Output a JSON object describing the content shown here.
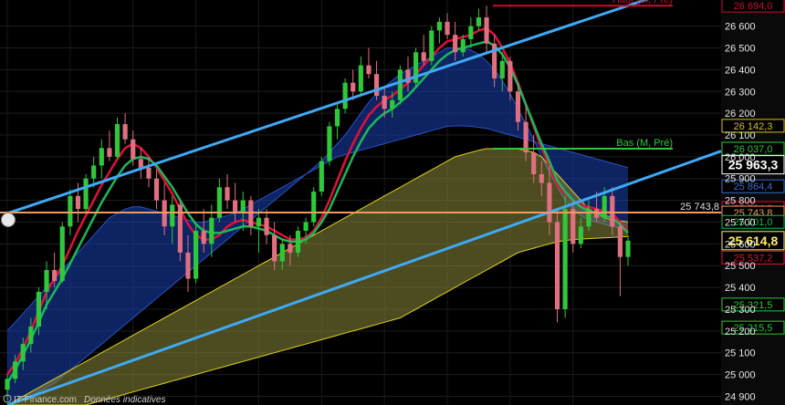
{
  "chart_data": {
    "type": "candlestick",
    "title": "",
    "y_axis": {
      "min": 24860,
      "max": 26720,
      "ticks": [
        24900,
        25000,
        25100,
        25200,
        25300,
        25400,
        25500,
        25600,
        25700,
        25800,
        25900,
        26000,
        26100,
        26200,
        26300,
        26400,
        26500,
        26600
      ],
      "tick_labels": [
        "24 900",
        "25 000",
        "25 100",
        "25 200",
        "25 300",
        "25 400",
        "25 500",
        "25 600",
        "25 700",
        "25 800",
        "25 900",
        "26 000",
        "26 100",
        "26 200",
        "26 300",
        "26 400",
        "26 500",
        "26 600"
      ]
    },
    "grid": true,
    "candles": [
      {
        "o": 24930,
        "h": 25000,
        "l": 24880,
        "c": 24980
      },
      {
        "o": 24980,
        "h": 25090,
        "l": 24960,
        "c": 25060
      },
      {
        "o": 25060,
        "h": 25170,
        "l": 25020,
        "c": 25140
      },
      {
        "o": 25140,
        "h": 25260,
        "l": 25100,
        "c": 25220
      },
      {
        "o": 25220,
        "h": 25400,
        "l": 25180,
        "c": 25380
      },
      {
        "o": 25380,
        "h": 25520,
        "l": 25300,
        "c": 25480
      },
      {
        "o": 25480,
        "h": 25560,
        "l": 25400,
        "c": 25430
      },
      {
        "o": 25430,
        "h": 25700,
        "l": 25420,
        "c": 25680
      },
      {
        "o": 25680,
        "h": 25850,
        "l": 25640,
        "c": 25820
      },
      {
        "o": 25820,
        "h": 25880,
        "l": 25700,
        "c": 25760
      },
      {
        "o": 25760,
        "h": 25920,
        "l": 25740,
        "c": 25900
      },
      {
        "o": 25900,
        "h": 26000,
        "l": 25860,
        "c": 25960
      },
      {
        "o": 25960,
        "h": 26080,
        "l": 25900,
        "c": 26040
      },
      {
        "o": 26040,
        "h": 26120,
        "l": 25980,
        "c": 26000
      },
      {
        "o": 26000,
        "h": 26180,
        "l": 25990,
        "c": 26150
      },
      {
        "o": 26150,
        "h": 26200,
        "l": 26060,
        "c": 26080
      },
      {
        "o": 26080,
        "h": 26120,
        "l": 25960,
        "c": 25990
      },
      {
        "o": 25990,
        "h": 26040,
        "l": 25900,
        "c": 25950
      },
      {
        "o": 25950,
        "h": 26000,
        "l": 25860,
        "c": 25900
      },
      {
        "o": 25900,
        "h": 25940,
        "l": 25760,
        "c": 25800
      },
      {
        "o": 25800,
        "h": 25880,
        "l": 25640,
        "c": 25680
      },
      {
        "o": 25680,
        "h": 25820,
        "l": 25600,
        "c": 25780
      },
      {
        "o": 25780,
        "h": 25800,
        "l": 25520,
        "c": 25560
      },
      {
        "o": 25560,
        "h": 25640,
        "l": 25380,
        "c": 25440
      },
      {
        "o": 25440,
        "h": 25700,
        "l": 25420,
        "c": 25660
      },
      {
        "o": 25660,
        "h": 25760,
        "l": 25560,
        "c": 25600
      },
      {
        "o": 25600,
        "h": 25780,
        "l": 25540,
        "c": 25720
      },
      {
        "o": 25720,
        "h": 25900,
        "l": 25700,
        "c": 25860
      },
      {
        "o": 25860,
        "h": 25920,
        "l": 25760,
        "c": 25800
      },
      {
        "o": 25800,
        "h": 25880,
        "l": 25700,
        "c": 25740
      },
      {
        "o": 25740,
        "h": 25840,
        "l": 25660,
        "c": 25800
      },
      {
        "o": 25800,
        "h": 25820,
        "l": 25640,
        "c": 25680
      },
      {
        "o": 25680,
        "h": 25760,
        "l": 25560,
        "c": 25720
      },
      {
        "o": 25720,
        "h": 25760,
        "l": 25600,
        "c": 25640
      },
      {
        "o": 25640,
        "h": 25700,
        "l": 25480,
        "c": 25520
      },
      {
        "o": 25520,
        "h": 25620,
        "l": 25480,
        "c": 25600
      },
      {
        "o": 25600,
        "h": 25640,
        "l": 25500,
        "c": 25560
      },
      {
        "o": 25560,
        "h": 25680,
        "l": 25540,
        "c": 25660
      },
      {
        "o": 25660,
        "h": 25720,
        "l": 25600,
        "c": 25700
      },
      {
        "o": 25700,
        "h": 25860,
        "l": 25680,
        "c": 25840
      },
      {
        "o": 25840,
        "h": 26000,
        "l": 25820,
        "c": 25980
      },
      {
        "o": 25980,
        "h": 26160,
        "l": 25960,
        "c": 26140
      },
      {
        "o": 26140,
        "h": 26240,
        "l": 26080,
        "c": 26220
      },
      {
        "o": 26220,
        "h": 26360,
        "l": 26200,
        "c": 26340
      },
      {
        "o": 26340,
        "h": 26400,
        "l": 26260,
        "c": 26300
      },
      {
        "o": 26300,
        "h": 26460,
        "l": 26280,
        "c": 26420
      },
      {
        "o": 26420,
        "h": 26500,
        "l": 26360,
        "c": 26380
      },
      {
        "o": 26380,
        "h": 26440,
        "l": 26260,
        "c": 26280
      },
      {
        "o": 26280,
        "h": 26320,
        "l": 26180,
        "c": 26220
      },
      {
        "o": 26220,
        "h": 26300,
        "l": 26180,
        "c": 26260
      },
      {
        "o": 26260,
        "h": 26420,
        "l": 26240,
        "c": 26400
      },
      {
        "o": 26400,
        "h": 26460,
        "l": 26300,
        "c": 26340
      },
      {
        "o": 26340,
        "h": 26500,
        "l": 26320,
        "c": 26480
      },
      {
        "o": 26480,
        "h": 26560,
        "l": 26420,
        "c": 26440
      },
      {
        "o": 26440,
        "h": 26600,
        "l": 26420,
        "c": 26580
      },
      {
        "o": 26580,
        "h": 26640,
        "l": 26520,
        "c": 26620
      },
      {
        "o": 26620,
        "h": 26660,
        "l": 26540,
        "c": 26560
      },
      {
        "o": 26560,
        "h": 26620,
        "l": 26440,
        "c": 26480
      },
      {
        "o": 26480,
        "h": 26560,
        "l": 26460,
        "c": 26540
      },
      {
        "o": 26540,
        "h": 26640,
        "l": 26500,
        "c": 26600
      },
      {
        "o": 26600,
        "h": 26680,
        "l": 26580,
        "c": 26640
      },
      {
        "o": 26640,
        "h": 26694,
        "l": 26480,
        "c": 26520
      },
      {
        "o": 26520,
        "h": 26560,
        "l": 26320,
        "c": 26360
      },
      {
        "o": 26360,
        "h": 26480,
        "l": 26300,
        "c": 26440
      },
      {
        "o": 26440,
        "h": 26460,
        "l": 26260,
        "c": 26300
      },
      {
        "o": 26300,
        "h": 26340,
        "l": 26120,
        "c": 26160
      },
      {
        "o": 26160,
        "h": 26240,
        "l": 25980,
        "c": 26020
      },
      {
        "o": 26020,
        "h": 26100,
        "l": 25880,
        "c": 25920
      },
      {
        "o": 25920,
        "h": 25980,
        "l": 25820,
        "c": 25880
      },
      {
        "o": 25880,
        "h": 25960,
        "l": 25640,
        "c": 25700
      },
      {
        "o": 25700,
        "h": 25760,
        "l": 25240,
        "c": 25300
      },
      {
        "o": 25300,
        "h": 25820,
        "l": 25260,
        "c": 25760
      },
      {
        "o": 25760,
        "h": 25800,
        "l": 25560,
        "c": 25600
      },
      {
        "o": 25600,
        "h": 25720,
        "l": 25580,
        "c": 25680
      },
      {
        "o": 25680,
        "h": 25800,
        "l": 25660,
        "c": 25760
      },
      {
        "o": 25760,
        "h": 25840,
        "l": 25700,
        "c": 25720
      },
      {
        "o": 25720,
        "h": 25860,
        "l": 25700,
        "c": 25820
      },
      {
        "o": 25820,
        "h": 25860,
        "l": 25640,
        "c": 25680
      },
      {
        "o": 25680,
        "h": 25700,
        "l": 25360,
        "c": 25540
      },
      {
        "o": 25540,
        "h": 25640,
        "l": 25500,
        "c": 25614.8
      }
    ],
    "channel_lines": [
      {
        "name": "",
        "color": "#3fa9f5",
        "points": [
          [
            0,
            25740
          ],
          [
            79,
            26694
          ]
        ]
      },
      {
        "name": "",
        "color": "#3fa9f5",
        "points": [
          [
            0,
            24860
          ],
          [
            120,
            26400
          ]
        ]
      }
    ],
    "moving_averages": [
      {
        "color": "#e0103a",
        "values": [
          25000,
          25050,
          25120,
          25200,
          25290,
          25380,
          25440,
          25500,
          25580,
          25660,
          25730,
          25800,
          25870,
          25930,
          25990,
          26040,
          26060,
          26040,
          26000,
          25950,
          25890,
          25830,
          25760,
          25690,
          25640,
          25620,
          25620,
          25640,
          25680,
          25700,
          25710,
          25700,
          25690,
          25680,
          25660,
          25640,
          25620,
          25620,
          25630,
          25660,
          25720,
          25800,
          25890,
          25980,
          26060,
          26130,
          26190,
          26230,
          26260,
          26280,
          26310,
          26340,
          26380,
          26420,
          26460,
          26500,
          26530,
          26540,
          26550,
          26560,
          26580,
          26590,
          26560,
          26500,
          26430,
          26340,
          26240,
          26140,
          26040,
          25960,
          25870,
          25830,
          25800,
          25780,
          25770,
          25760,
          25750,
          25740,
          25700,
          25660
        ]
      },
      {
        "color": "#1ab85a",
        "values": [
          24960,
          25020,
          25090,
          25160,
          25240,
          25320,
          25380,
          25440,
          25510,
          25580,
          25650,
          25720,
          25790,
          25850,
          25910,
          25960,
          25990,
          26000,
          25990,
          25960,
          25910,
          25860,
          25800,
          25740,
          25690,
          25660,
          25650,
          25650,
          25660,
          25670,
          25680,
          25680,
          25670,
          25660,
          25640,
          25620,
          25610,
          25610,
          25620,
          25650,
          25700,
          25760,
          25840,
          25920,
          26000,
          26070,
          26130,
          26170,
          26200,
          26220,
          26250,
          26280,
          26320,
          26360,
          26400,
          26440,
          26470,
          26490,
          26500,
          26510,
          26520,
          26530,
          26510,
          26470,
          26410,
          26330,
          26240,
          26150,
          26060,
          25980,
          25890,
          25840,
          25800,
          25770,
          25750,
          25740,
          25730,
          25720,
          25690,
          25650
        ]
      }
    ],
    "bands": [
      {
        "name": "",
        "color": "#1a3fb0",
        "upper": [
          25200,
          25240,
          25280,
          25320,
          25360,
          25400,
          25440,
          25480,
          25520,
          25560,
          25600,
          25640,
          25680,
          25720,
          25740,
          25760,
          25770,
          25770,
          25760,
          25750,
          25740,
          25730,
          25720,
          25710,
          25700,
          25700,
          25710,
          25720,
          25730,
          25740,
          25760,
          25780,
          25800,
          25820,
          25840,
          25860,
          25880,
          25900,
          25920,
          25950,
          25980,
          26020,
          26060,
          26100,
          26150,
          26200,
          26250,
          26290,
          26320,
          26350,
          26380,
          26400,
          26420,
          26440,
          26460,
          26480,
          26500,
          26500,
          26500,
          26490,
          26470,
          26440,
          26400,
          26350,
          26290,
          26220,
          26150,
          26080,
          26000,
          25930,
          25860,
          25800,
          25760,
          25730,
          25710,
          25700,
          25690,
          25680,
          25670,
          25660
        ],
        "lower": [
          24860,
          24870,
          24880,
          24900,
          24920,
          24940,
          24960,
          24990,
          25020,
          25050,
          25080,
          25110,
          25140,
          25170,
          25200,
          25230,
          25260,
          25290,
          25320,
          25350,
          25380,
          25410,
          25440,
          25470,
          25500,
          25530,
          25560,
          25590,
          25620,
          25650,
          25680,
          25710,
          25740,
          25770,
          25800,
          25830,
          25860,
          25890,
          25920,
          25940,
          25960,
          25980,
          26000,
          26010,
          26020,
          26030,
          26040,
          26050,
          26060,
          26070,
          26080,
          26090,
          26100,
          26110,
          26120,
          26130,
          26140,
          26142,
          26142,
          26140,
          26135,
          26130,
          26120,
          26110,
          26100,
          26090,
          26080,
          26070,
          26060,
          26050,
          26040,
          26030,
          26020,
          26010,
          26000,
          25990,
          25980,
          25970,
          25960,
          25950
        ]
      },
      {
        "name": "",
        "color": "#8a8a3a",
        "upper": [
          24860,
          24880,
          24900,
          24920,
          24940,
          24960,
          24980,
          25000,
          25020,
          25040,
          25060,
          25080,
          25100,
          25120,
          25140,
          25160,
          25180,
          25200,
          25220,
          25240,
          25260,
          25280,
          25300,
          25320,
          25340,
          25360,
          25380,
          25400,
          25420,
          25440,
          25460,
          25480,
          25500,
          25520,
          25540,
          25560,
          25580,
          25600,
          25620,
          25640,
          25660,
          25680,
          25700,
          25720,
          25740,
          25760,
          25780,
          25800,
          25820,
          25840,
          25860,
          25880,
          25900,
          25920,
          25940,
          25960,
          25980,
          26000,
          26010,
          26020,
          26030,
          26037,
          26037,
          26037,
          26037,
          26035,
          26030,
          26020,
          26000,
          25960,
          25920,
          25880,
          25840,
          25800,
          25760,
          25740,
          25720,
          25710,
          25705,
          25701
        ],
        "lower": [
          24860,
          24860,
          24860,
          24860,
          24860,
          24860,
          24860,
          24860,
          24860,
          24860,
          24860,
          24870,
          24880,
          24890,
          24900,
          24910,
          24920,
          24930,
          24940,
          24950,
          24960,
          24970,
          24980,
          24990,
          25000,
          25010,
          25020,
          25030,
          25040,
          25050,
          25060,
          25070,
          25080,
          25090,
          25100,
          25110,
          25120,
          25130,
          25140,
          25150,
          25160,
          25170,
          25180,
          25190,
          25200,
          25210,
          25220,
          25230,
          25240,
          25250,
          25260,
          25280,
          25300,
          25320,
          25340,
          25360,
          25380,
          25400,
          25420,
          25440,
          25460,
          25480,
          25500,
          25520,
          25540,
          25560,
          25570,
          25580,
          25590,
          25600,
          25610,
          25615,
          25620,
          25622,
          25624,
          25626,
          25628,
          25630,
          25632,
          25634
        ]
      }
    ],
    "levels": [
      {
        "label": "26 694,0",
        "value": 26694,
        "color": "#c8102e",
        "line": "Haut (M, Pré)",
        "line_color": "#c8102e"
      },
      {
        "label": "26 142,3",
        "value": 26142.3,
        "color": "#d4c020"
      },
      {
        "label": "26 037,0",
        "value": 26037,
        "color": "#2ec83a",
        "line": "Bas (M, Pré)",
        "line_color": "#2ec83a"
      },
      {
        "label": "25 963,3",
        "value": 25963.3,
        "color": "#ffffff",
        "big": true
      },
      {
        "label": "25 864,4",
        "value": 25864.4,
        "color": "#3a6ad0"
      },
      {
        "label": "25 764,8",
        "value": 25764.8,
        "color": "#e0103a"
      },
      {
        "label": "25 743,8",
        "value": 25743.8,
        "color": "#f39a60",
        "side_label": "25 743,8"
      },
      {
        "label": "25 701,0",
        "value": 25701,
        "color": "#1ab85a"
      },
      {
        "label": "25 614,8",
        "value": 25614.8,
        "color": "#ffee66",
        "big": true
      },
      {
        "label": "25 537,2",
        "value": 25537.2,
        "color": "#e0103a"
      },
      {
        "label": "25 321,5",
        "value": 25321.5,
        "color": "#2ec83a"
      },
      {
        "label": "25 215,5",
        "value": 25215.5,
        "color": "#2ec83a"
      }
    ],
    "footer": {
      "brand": "IT-Finance.com",
      "note": "Données indicatives"
    }
  }
}
